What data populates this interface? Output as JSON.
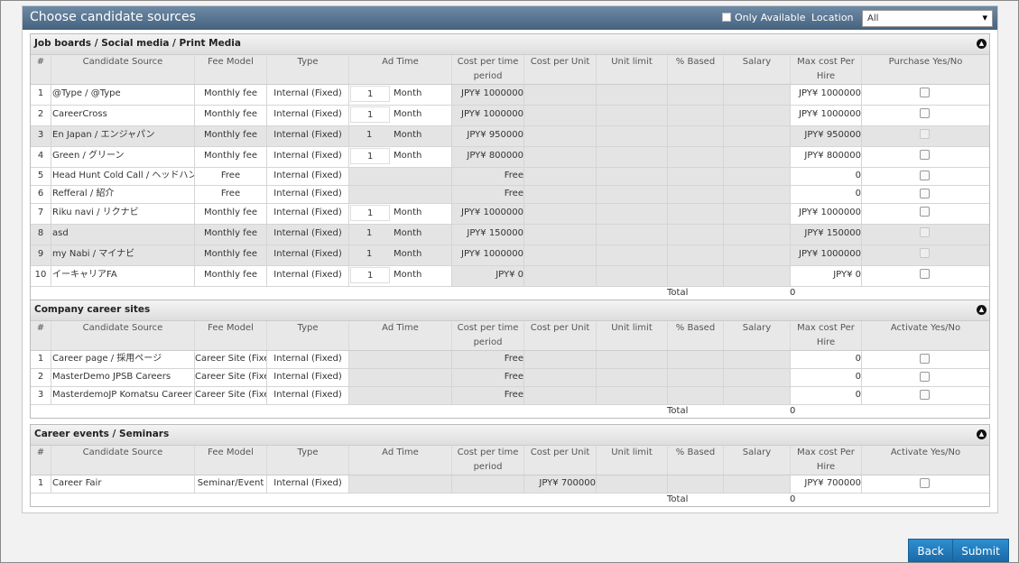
{
  "header": {
    "title": "Choose candidate sources",
    "only_available": "Only Available",
    "location_label": "Location",
    "location_value": "All"
  },
  "columns": {
    "num": "#",
    "source": "Candidate Source",
    "fee": "Fee Model",
    "type": "Type",
    "ad": "Ad Time",
    "cptp": "Cost per time period",
    "cpu": "Cost per Unit",
    "ul": "Unit limit",
    "pb": "% Based",
    "sal": "Salary",
    "max": "Max cost Per Hire",
    "purchase": "Purchase Yes/No",
    "activate": "Activate Yes/No"
  },
  "sections": [
    {
      "title": "Job boards / Social media / Print Media",
      "total_label": "Total",
      "total_value": "0",
      "rows": [
        {
          "n": "1",
          "src": "@Type / @Type",
          "fee": "Monthly fee",
          "type": "Internal (Fixed)",
          "ad": "1",
          "unit": "Month",
          "cost": "JPY¥ 1000000",
          "max": "JPY¥ 1000000",
          "dis": false
        },
        {
          "n": "2",
          "src": "CareerCross",
          "fee": "Monthly fee",
          "type": "Internal (Fixed)",
          "ad": "1",
          "unit": "Month",
          "cost": "JPY¥ 1000000",
          "max": "JPY¥ 1000000",
          "dis": false
        },
        {
          "n": "3",
          "src": "En Japan / エンジャパン",
          "fee": "Monthly fee",
          "type": "Internal (Fixed)",
          "ad": "1",
          "unit": "Month",
          "cost": "JPY¥ 950000",
          "max": "JPY¥ 950000",
          "dis": true
        },
        {
          "n": "4",
          "src": "Green / グリーン",
          "fee": "Monthly fee",
          "type": "Internal (Fixed)",
          "ad": "1",
          "unit": "Month",
          "cost": "JPY¥ 800000",
          "max": "JPY¥ 800000",
          "dis": false
        },
        {
          "n": "5",
          "src": "Head Hunt Cold Call / ヘッドハント",
          "fee": "Free",
          "type": "Internal (Fixed)",
          "ad": "",
          "unit": "",
          "cost": "Free",
          "max": "0",
          "dis": false,
          "sm": true
        },
        {
          "n": "6",
          "src": "Refferal / 紹介",
          "fee": "Free",
          "type": "Internal (Fixed)",
          "ad": "",
          "unit": "",
          "cost": "Free",
          "max": "0",
          "dis": false,
          "sm": true
        },
        {
          "n": "7",
          "src": "Riku navi / リクナビ",
          "fee": "Monthly fee",
          "type": "Internal (Fixed)",
          "ad": "1",
          "unit": "Month",
          "cost": "JPY¥ 1000000",
          "max": "JPY¥ 1000000",
          "dis": false
        },
        {
          "n": "8",
          "src": "asd",
          "fee": "Monthly fee",
          "type": "Internal (Fixed)",
          "ad": "1",
          "unit": "Month",
          "cost": "JPY¥ 150000",
          "max": "JPY¥ 150000",
          "dis": true
        },
        {
          "n": "9",
          "src": "my Nabi / マイナビ",
          "fee": "Monthly fee",
          "type": "Internal (Fixed)",
          "ad": "1",
          "unit": "Month",
          "cost": "JPY¥ 1000000",
          "max": "JPY¥ 1000000",
          "dis": true
        },
        {
          "n": "10",
          "src": "イーキャリアFA",
          "fee": "Monthly fee",
          "type": "Internal (Fixed)",
          "ad": "1",
          "unit": "Month",
          "cost": "JPY¥ 0",
          "max": "JPY¥ 0",
          "dis": false
        }
      ]
    },
    {
      "title": "Company career sites",
      "total_label": "Total",
      "total_value": "0",
      "rows": [
        {
          "n": "1",
          "src": "Career page / 採用ページ",
          "fee": "Career Site (Fixe",
          "type": "Internal (Fixed)",
          "cost": "Free",
          "max": "0"
        },
        {
          "n": "2",
          "src": "MasterDemo JPSB Careers",
          "fee": "Career Site (Fixe",
          "type": "Internal (Fixed)",
          "cost": "Free",
          "max": "0"
        },
        {
          "n": "3",
          "src": "MasterdemoJP Komatsu Career",
          "fee": "Career Site (Fixe",
          "type": "Internal (Fixed)",
          "cost": "Free",
          "max": "0"
        }
      ]
    },
    {
      "title": "Career events / Seminars",
      "total_label": "Total",
      "total_value": "0",
      "rows": [
        {
          "n": "1",
          "src": "Career Fair",
          "fee": "Seminar/Event",
          "type": "Internal (Fixed)",
          "cpu": "JPY¥ 700000",
          "max": "JPY¥ 700000"
        }
      ]
    }
  ],
  "buttons": {
    "back": "Back",
    "submit": "Submit"
  }
}
